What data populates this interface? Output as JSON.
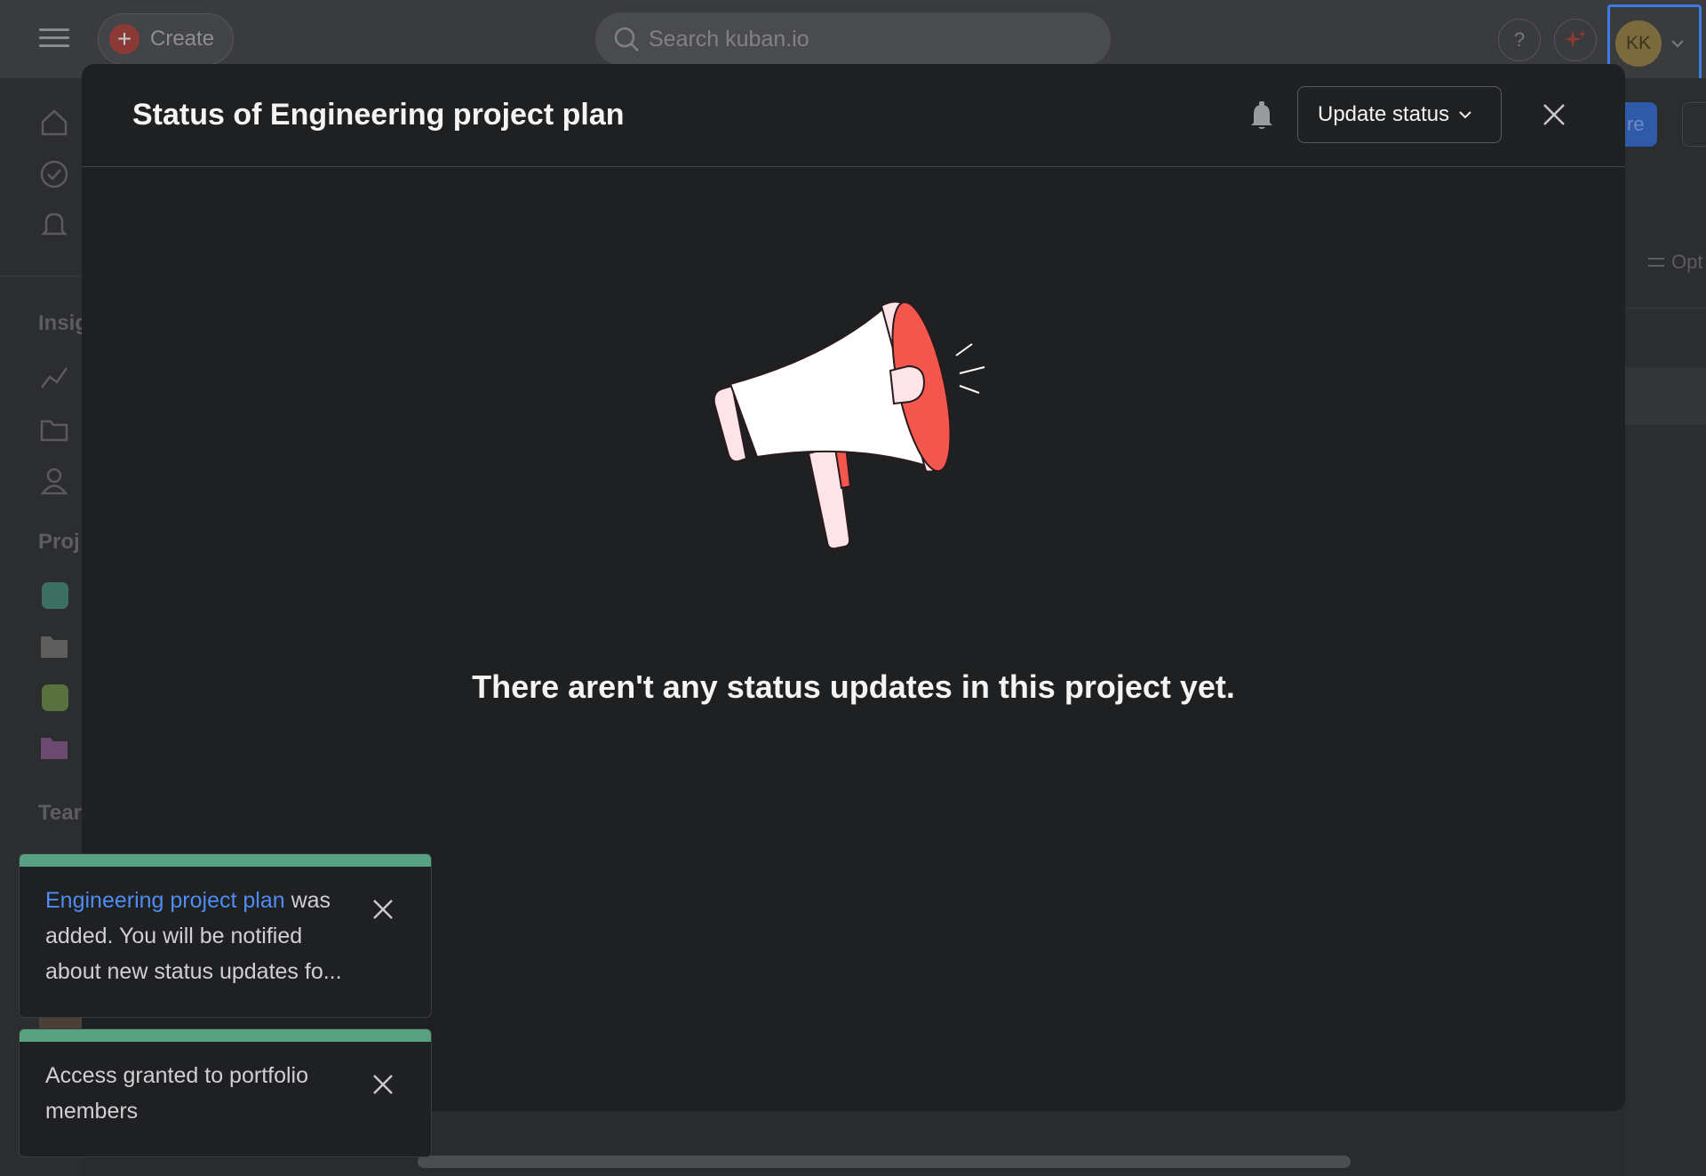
{
  "topbar": {
    "create_label": "Create",
    "search_placeholder": "Search kuban.io",
    "help_label": "?",
    "avatar_initials": "KK"
  },
  "sidebar": {
    "insights_label": "Insig",
    "projects_label": "Proj",
    "teams_label": "Tear",
    "project_colors": [
      "#3d6e62",
      "#5f5f60",
      "#59703f",
      "#6b4a72"
    ]
  },
  "right_panel": {
    "share_fragment": "re",
    "options_fragment": "Opt"
  },
  "modal": {
    "title": "Status of Engineering project plan",
    "update_status_label": "Update status",
    "empty_message": "There aren't any status updates in this project yet."
  },
  "toasts": [
    {
      "link_text": "Engineering project plan",
      "text_line1": " was",
      "text_rest": "added. You will be notified about new status updates fo..."
    },
    {
      "text": "Access granted to portfolio members"
    }
  ],
  "colors": {
    "accent_blue": "#3b7be6",
    "toast_success": "#58a182",
    "megaphone_red": "#f2564d"
  }
}
